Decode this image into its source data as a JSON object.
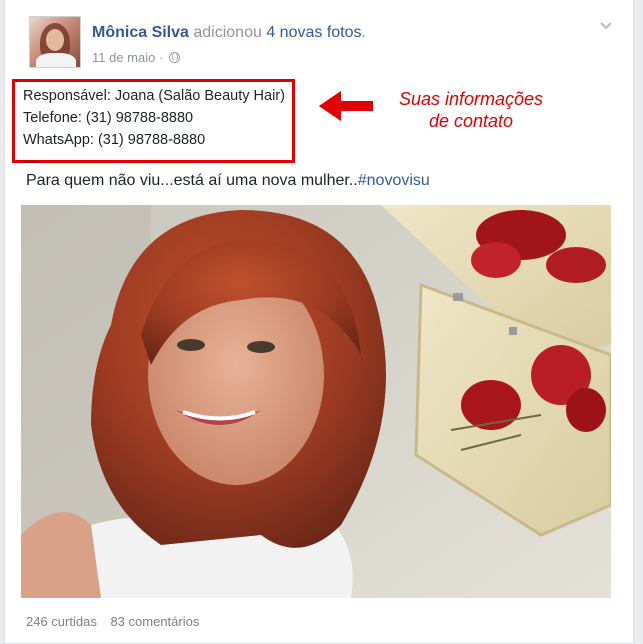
{
  "post": {
    "author_name": "Mônica Silva",
    "action_text": "adicionou",
    "action_link": "4 novas fotos",
    "action_suffix": ".",
    "date": "11 de maio",
    "date_separator": "·",
    "audience_icon": "globe-icon",
    "options_icon": "chevron-down-icon",
    "caption_text": "Para quem não viu...está aí uma nova mulher..",
    "hashtag": "#novovisu",
    "photo_description_icon": "photo"
  },
  "contact_box": {
    "line1": "Responsável: Joana (Salão Beauty Hair)",
    "line2": "Telefone: (31) 98788-8880",
    "line3": "WhatsApp: (31) 98788-8880",
    "line4": "---"
  },
  "annotation": {
    "line1": "Suas informações",
    "line2": "de contato",
    "color": "#e00000"
  },
  "stats": {
    "likes": "246 curtidas",
    "comments": "83 comentários"
  },
  "colors": {
    "link_blue": "#365899",
    "meta_gray": "#90949c",
    "highlight_red": "#e20000"
  }
}
